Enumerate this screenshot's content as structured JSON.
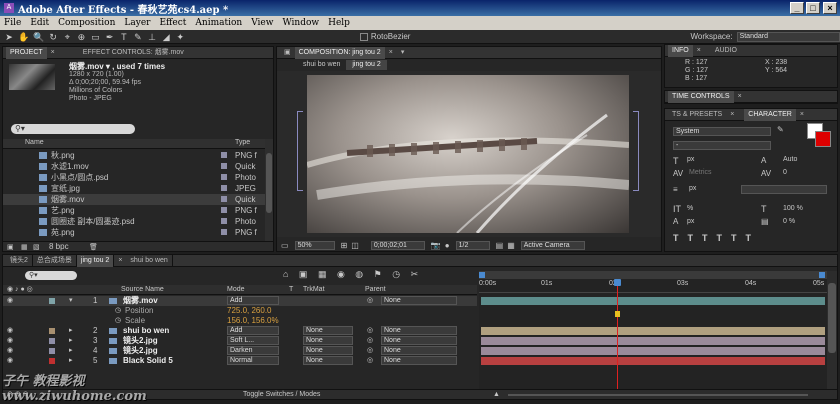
{
  "window": {
    "title": "Adobe After Effects - 春秋艺苑cs4.aep *"
  },
  "menu": [
    "File",
    "Edit",
    "Composition",
    "Layer",
    "Effect",
    "Animation",
    "View",
    "Window",
    "Help"
  ],
  "toolbar": {
    "rotobezier_label": "RotoBezier",
    "workspace_label": "Workspace:",
    "workspace_value": "Standard"
  },
  "project": {
    "tab_project": "PROJECT",
    "tab_effect_controls": "EFFECT CONTROLS: 烟雾.mov",
    "info_name": "烟雾.mov ▾ , used 7 times",
    "info_lines": [
      "1280 x 720 (1.00)",
      "Δ 0;00;20;00, 59.94 fps",
      "Millions of Colors",
      "Photo - JPEG"
    ],
    "col_name": "Name",
    "col_type": "Type",
    "items": [
      {
        "name": "秋.png",
        "type": "PNG f",
        "color": "#8f8fa8"
      },
      {
        "name": "水滤1.mov",
        "type": "Quick",
        "color": "#8f8fa8"
      },
      {
        "name": "小黑点/圆点.psd",
        "type": "Photo",
        "color": "#8f8fa8"
      },
      {
        "name": "宣纸.jpg",
        "type": "JPEG",
        "color": "#8f8fa8"
      },
      {
        "name": "烟雾.mov",
        "type": "Quick",
        "color": "#8f8fa8"
      },
      {
        "name": "艺.png",
        "type": "PNG f",
        "color": "#8f8fa8"
      },
      {
        "name": "圆圈迹 副本/圆墨迹.psd",
        "type": "Photo",
        "color": "#8f8fa8"
      },
      {
        "name": "苑.png",
        "type": "PNG f",
        "color": "#8f8fa8"
      }
    ],
    "bpc_label": "8 bpc"
  },
  "composition": {
    "tab_label": "COMPOSITION: jing tou 2",
    "breadcrumbs": [
      "shui bo wen",
      "jing tou 2"
    ],
    "zoom": "50%",
    "timecode": "0;00;02;01",
    "resolution": "1/2",
    "camera": "Active Camera"
  },
  "info_panel": {
    "tab_info": "INFO",
    "tab_audio": "AUDIO",
    "r": "R : 127",
    "g": "G : 127",
    "b": "B : 127",
    "x": "X : 238",
    "y": "Y : 564"
  },
  "time_controls": {
    "tab": "TIME CONTROLS"
  },
  "character": {
    "tab_presets": "TS & PRESETS",
    "tab_character": "CHARACTER",
    "font": "System",
    "style": "-",
    "size_unit": "px",
    "leading": "Auto",
    "tracking": "0",
    "metrics_label": "Metrics",
    "stroke_unit": "px",
    "vscale": "%",
    "hscale": "100 %",
    "baseline": "px",
    "tsume": "0 %"
  },
  "timeline": {
    "tabs": [
      "镜头2",
      "总合成场景",
      "jing tou 2",
      "shui bo wen"
    ],
    "active_tab": "jing tou 2",
    "col_source": "Source Name",
    "col_mode": "Mode",
    "col_t": "T",
    "col_trkmat": "TrkMat",
    "col_parent": "Parent",
    "ruler_labels": [
      "0:00s",
      "01s",
      "02s",
      "03s",
      "04s",
      "05s"
    ],
    "layers": [
      {
        "num": "1",
        "name": "烟雾.mov",
        "mode": "Add",
        "trkmat": "",
        "parent": "None",
        "color": "#7fa3a8",
        "bar": "#5d8d8c"
      },
      {
        "num": "2",
        "name": "shui bo wen",
        "mode": "Add",
        "trkmat": "None",
        "parent": "None",
        "color": "#a89070",
        "bar": "#b0a080"
      },
      {
        "num": "3",
        "name": "镜头2.jpg",
        "mode": "Soft L...",
        "trkmat": "None",
        "parent": "None",
        "color": "#8f8fa8",
        "bar": "#9a8a9a"
      },
      {
        "num": "4",
        "name": "镜头2.jpg",
        "mode": "Darken",
        "trkmat": "None",
        "parent": "None",
        "color": "#8f8fa8",
        "bar": "#9a8a9a"
      },
      {
        "num": "5",
        "name": "Black Solid 5",
        "mode": "Normal",
        "trkmat": "None",
        "parent": "None",
        "color": "#c03030",
        "bar": "#b84040"
      }
    ],
    "props": [
      {
        "label": "Position",
        "value": "725.0, 260.0"
      },
      {
        "label": "Scale",
        "value": "156.0, 156.0%"
      }
    ],
    "toggle_label": "Toggle Switches / Modes",
    "playhead_seconds": 2.03
  },
  "watermark": "子午 教程影视 www.ziwuhome.com"
}
